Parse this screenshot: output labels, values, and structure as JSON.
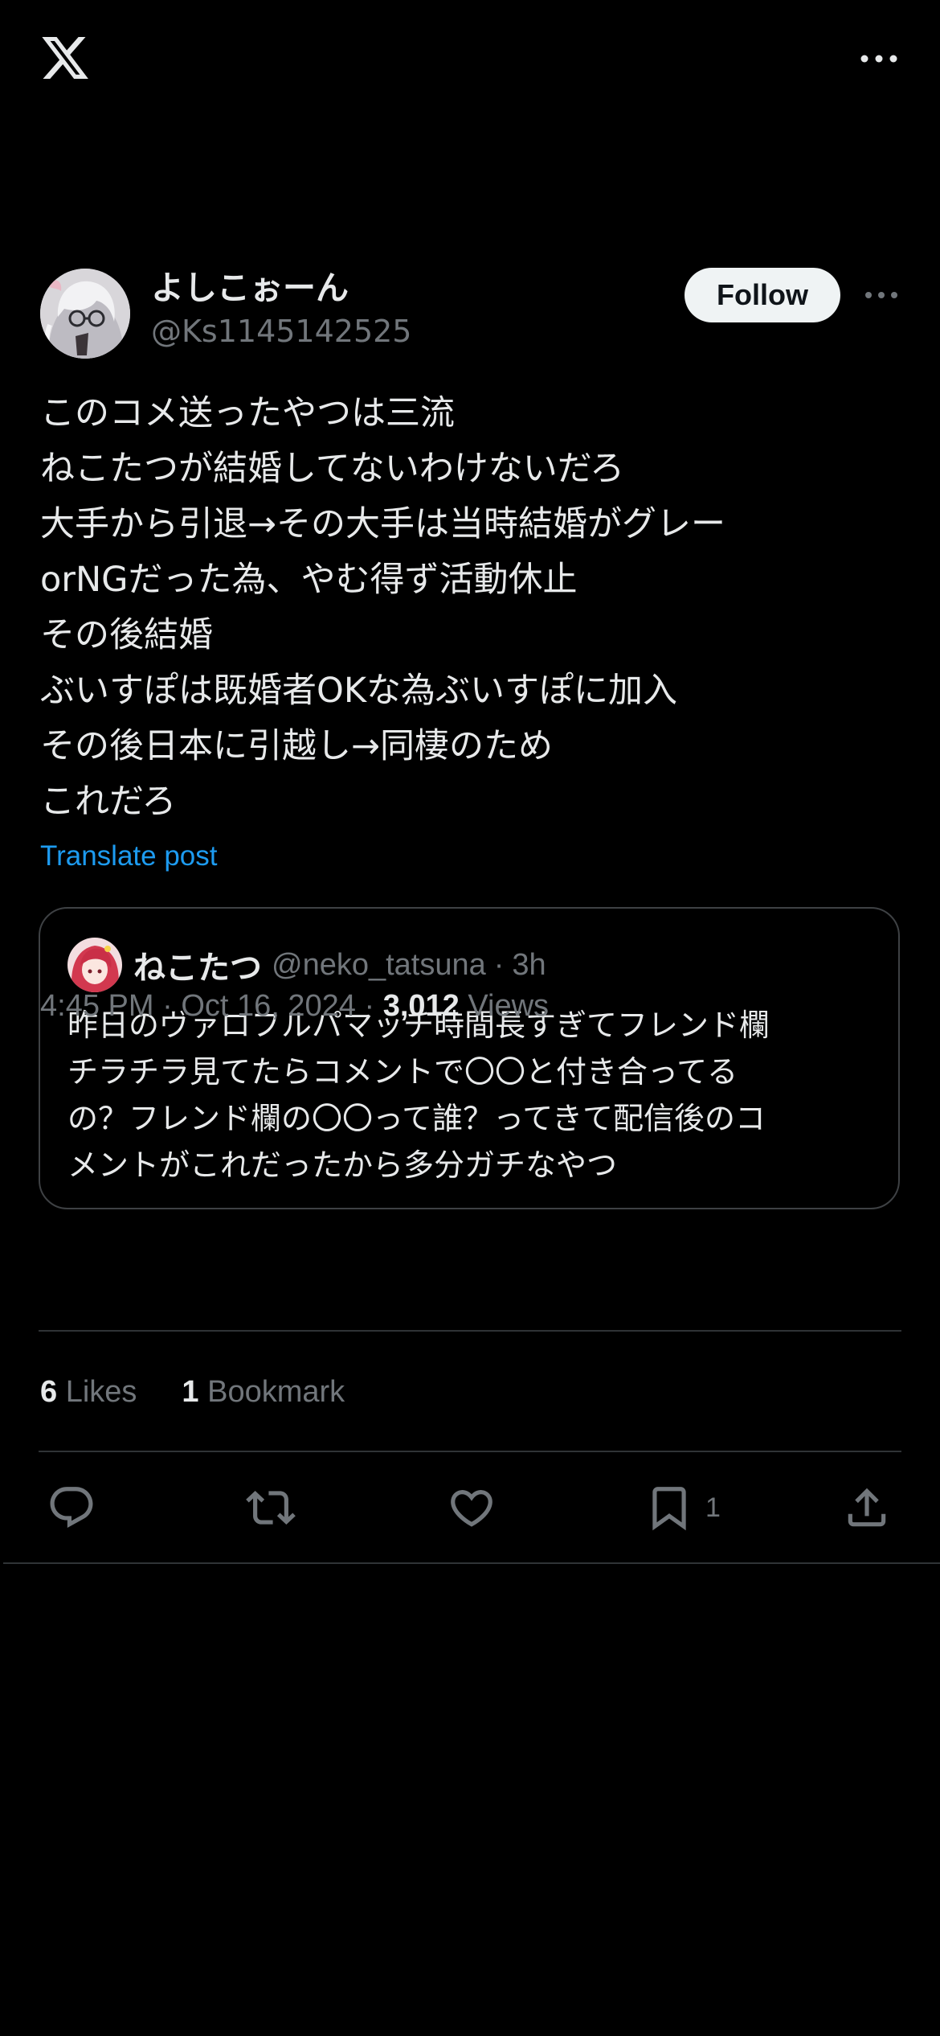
{
  "author": {
    "display_name": "よしこぉーん",
    "handle": "@Ks1145142525",
    "follow_label": "Follow"
  },
  "post": {
    "lines": [
      "このコメ送ったやつは三流",
      "ねこたつが結婚してないわけないだろ",
      "大手から引退→その大手は当時結婚がグレー",
      "orNGだった為、やむ得ず活動休止",
      "その後結婚",
      "ぶいすぽは既婚者OKな為ぶいすぽに加入",
      "その後日本に引越し→同棲のため",
      "これだろ"
    ],
    "translate_label": "Translate post"
  },
  "quote": {
    "name": "ねこたつ",
    "handle": "@neko_tatsuna",
    "separator": "·",
    "time": "3h",
    "lines": [
      "昨日のヴァロフルパマッチ時間長すぎてフレンド欄",
      "チラチラ見てたらコメントで〇〇と付き合ってる",
      "の？フレンド欄の〇〇って誰？ってきて配信後のコ",
      "メントがこれだったから多分ガチなやつ"
    ]
  },
  "meta": {
    "time": "4:45 PM",
    "date": "Oct 16, 2024",
    "separator": "·",
    "views_count": "3,012",
    "views_label": "Views"
  },
  "stats": {
    "likes_count": "6",
    "likes_label": "Likes",
    "bookmarks_count": "1",
    "bookmarks_label": "Bookmark"
  },
  "actions": {
    "bookmark_count": "1"
  },
  "icons": {
    "logo": "x-logo-icon",
    "more": "more-horizontal-icon",
    "reply": "reply-icon",
    "repost": "repost-icon",
    "like": "like-icon",
    "bookmark": "bookmark-icon",
    "share": "share-icon"
  },
  "colors": {
    "background": "#000000",
    "text": "#e7e9ea",
    "secondary": "#71767b",
    "link": "#1d9bf0",
    "divider": "#2f3336"
  }
}
